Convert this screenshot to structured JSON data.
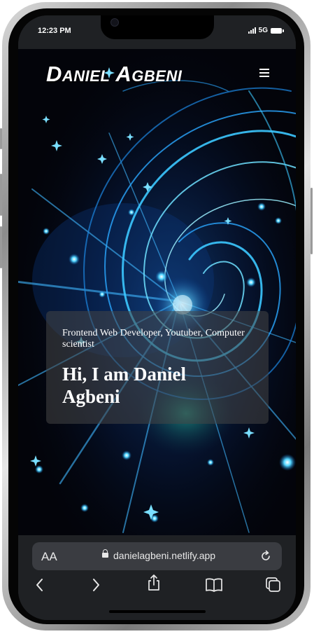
{
  "status_bar": {
    "time": "12:23 PM",
    "network": "5G"
  },
  "site": {
    "brand": "Daniel Agbeni",
    "menu_icon": "hamburger-menu-icon",
    "hero": {
      "tagline": "Frontend Web Developer, Youtuber, Computer scientist",
      "heading": "Hi, I am Daniel Agbeni"
    },
    "background": "blue-neon-light-swirl-image"
  },
  "browser": {
    "text_size_label": "AA",
    "url": "danielagbeni.netlify.app",
    "icons": {
      "lock": "lock-icon",
      "reload": "reload-icon",
      "back": "back-icon",
      "forward": "forward-icon",
      "share": "share-icon",
      "bookmarks": "book-icon",
      "tabs": "tabs-icon"
    }
  },
  "colors": {
    "browser_chrome": "#1f2124",
    "url_bar": "#3a3c41",
    "neon_accent": "#36c8ff"
  }
}
